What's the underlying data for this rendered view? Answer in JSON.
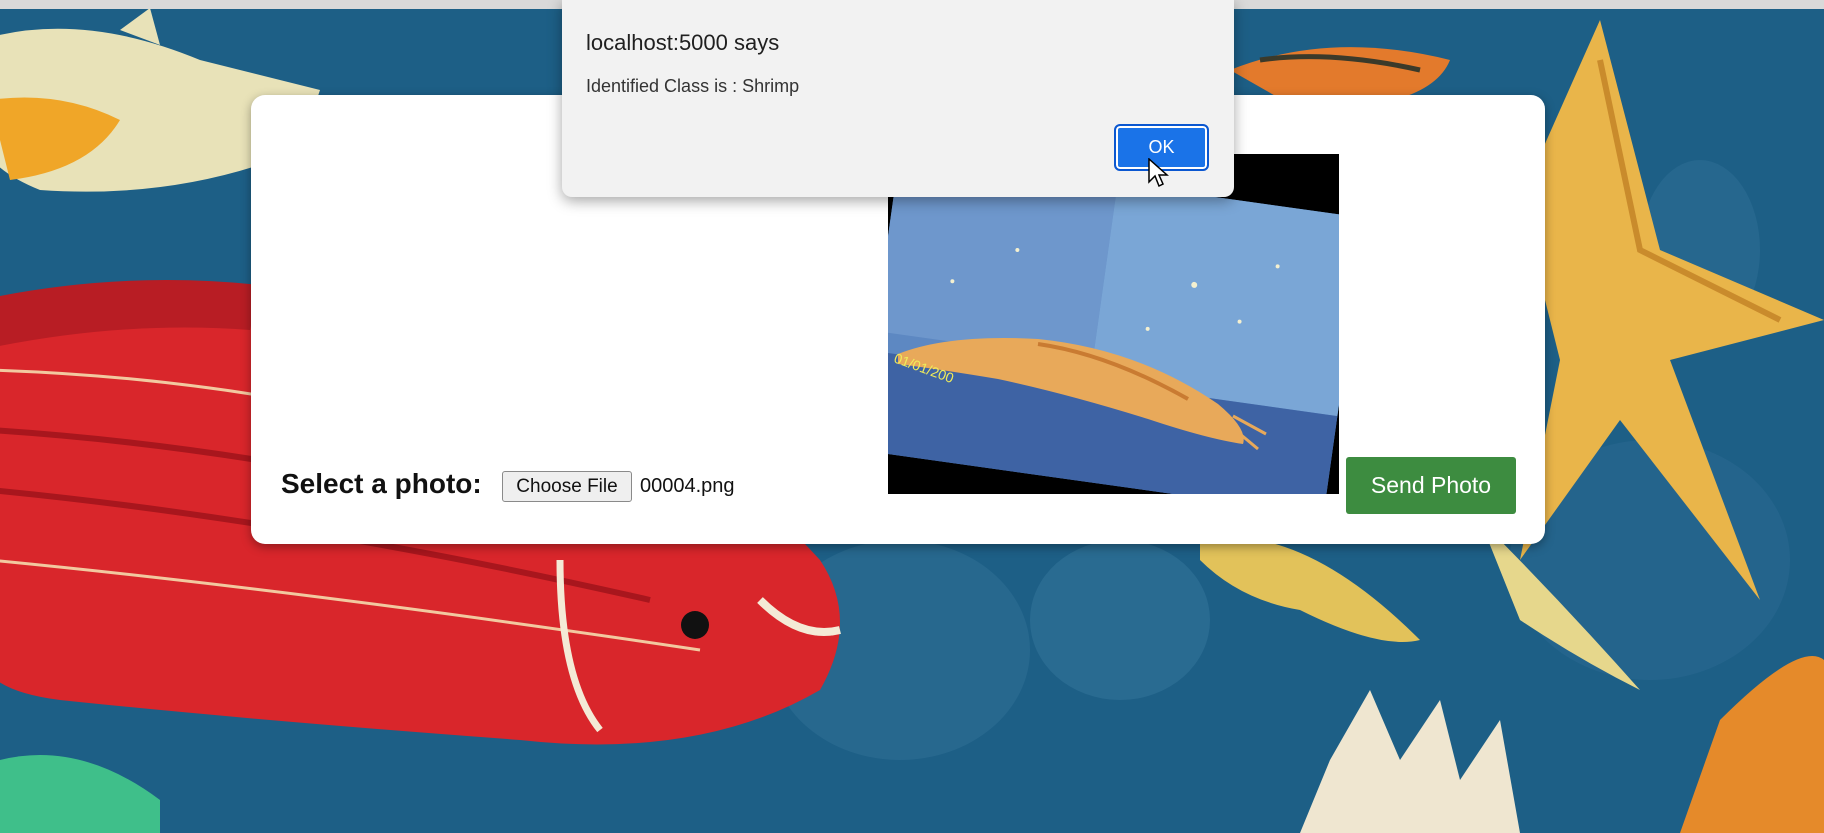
{
  "background": {
    "name": "sea-life-painting",
    "accent": "#1d5f86"
  },
  "form": {
    "select_label": "Select a photo:",
    "file_button_label": "Choose File",
    "file_name": "00004.png",
    "send_button_label": "Send Photo",
    "send_button_color": "#3d8c40",
    "photo_stamp": "01/01/200"
  },
  "dialog": {
    "title": "localhost:5000 says",
    "message": "Identified Class is : Shrimp",
    "ok_label": "OK",
    "ok_color": "#1a73e8"
  },
  "cursor": {
    "icon": "arrow-cursor-icon"
  }
}
